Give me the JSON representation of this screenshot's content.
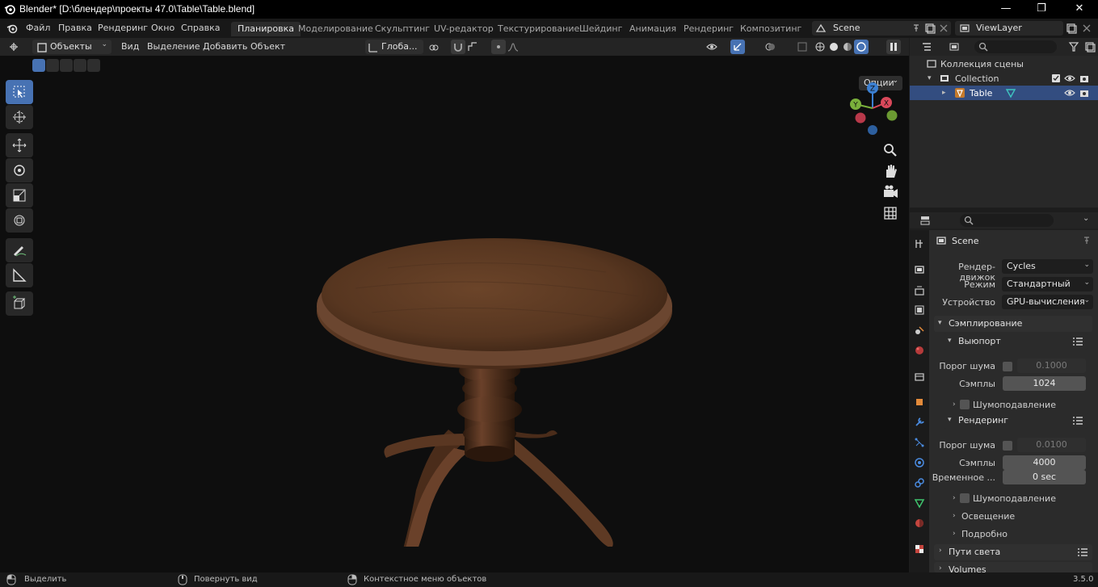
{
  "window": {
    "title": "Blender* [D:\\блендер\\проекты 47.0\\Table\\Table.blend]",
    "minimize": "—",
    "maximize": "❐",
    "close": "✕"
  },
  "menu": {
    "items": [
      "Файл",
      "Правка",
      "Рендеринг",
      "Окно",
      "Справка"
    ],
    "workspaces": [
      "Планировка",
      "Моделирование",
      "Скульптинг",
      "UV-редактор",
      "Текстурирование",
      "Шейдинг",
      "Анимация",
      "Рендеринг",
      "Композитинг"
    ],
    "active_workspace": "Планировка",
    "scene": "Scene",
    "view_layer": "ViewLayer"
  },
  "viewport": {
    "mode": "Объекты",
    "menus": [
      "Вид",
      "Выделение",
      "Добавить",
      "Объект"
    ],
    "orientation": "Глоба...",
    "options": "Опции",
    "gizmo": {
      "x": "X",
      "y": "Y",
      "z": "Z"
    }
  },
  "outliner": {
    "scene_collection": "Коллекция сцены",
    "collection": "Collection",
    "object": "Table"
  },
  "properties": {
    "context": "Scene",
    "render_engine_label": "Рендер-движок",
    "render_engine": "Cycles",
    "mode_label": "Режим",
    "mode": "Стандартный",
    "device_label": "Устройство",
    "device": "GPU-вычисления",
    "sampling": "Сэмплирование",
    "viewport_section": "Выюпорт",
    "noise_threshold_label": "Порог шума",
    "viewport_noise_threshold": "0.1000",
    "samples_label": "Сэмплы",
    "viewport_samples": "1024",
    "denoise": "Шумоподавление",
    "render_section": "Рендеринг",
    "render_noise_threshold": "0.0100",
    "render_samples": "4000",
    "time_limit_label": "Временное ...",
    "time_limit": "0 sec",
    "render_denoise": "Шумоподавление",
    "lighting": "Освещение",
    "advanced": "Подробно",
    "light_paths": "Пути света",
    "volumes": "Volumes"
  },
  "statusbar": {
    "select": "Выделить",
    "rotate_view": "Повернуть вид",
    "context_menu": "Контекстное меню объектов",
    "version": "3.5.0"
  },
  "colors": {
    "accent": "#4772b3",
    "selection": "#334d80",
    "wood": "#5a3a22"
  }
}
